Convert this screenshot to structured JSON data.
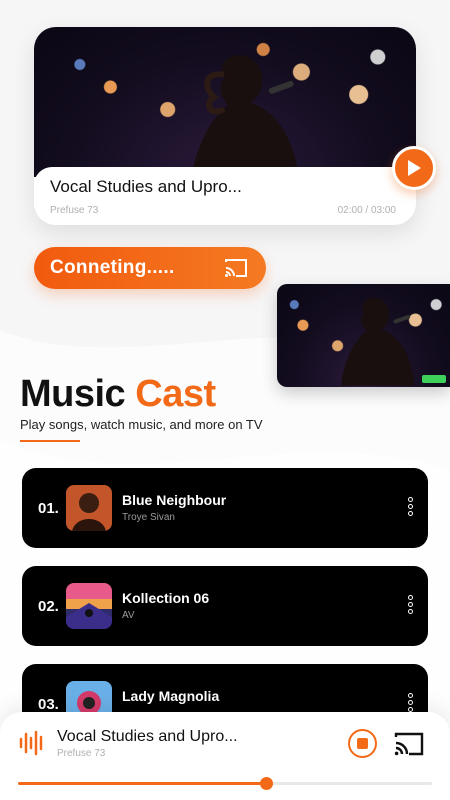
{
  "now_playing_card": {
    "title": "Vocal Studies and Upro...",
    "artist": "Prefuse 73",
    "time": "02:00 / 03:00"
  },
  "connect": {
    "label": "Conneting....."
  },
  "hero": {
    "title_main": "Music",
    "title_accent": "Cast",
    "subtitle": "Play songs, watch music, and more on TV"
  },
  "tracks": [
    {
      "number": "01.",
      "name": "Blue Neighbour",
      "artist": "Troye Sivan"
    },
    {
      "number": "02.",
      "name": "Kollection 06",
      "artist": "AV"
    },
    {
      "number": "03.",
      "name": "Lady Magnolia",
      "artist": ""
    }
  ],
  "player": {
    "title": "Vocal Studies and Upro...",
    "artist": "Prefuse 73",
    "progress": 0.6
  },
  "colors": {
    "accent": "#f26a17",
    "card": "#000000",
    "background": "#f6f6f7"
  },
  "icons": {
    "play": "play-icon",
    "cast": "cast-icon",
    "more": "more-vertical-icon",
    "wave": "audio-wave-icon",
    "stop": "stop-icon"
  }
}
